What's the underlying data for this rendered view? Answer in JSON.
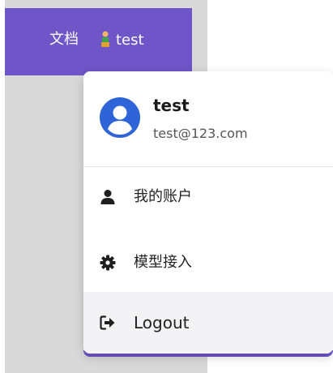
{
  "topbar": {
    "docs_label": "文档",
    "user_name": "test"
  },
  "menu": {
    "user": {
      "name": "test",
      "email": "test@123.com"
    },
    "items": [
      {
        "label": "我的账户",
        "icon": "user-icon"
      },
      {
        "label": "模型接入",
        "icon": "gear-icon"
      },
      {
        "label": "Logout",
        "icon": "logout-icon"
      }
    ]
  },
  "colors": {
    "brand": "#6e56c8",
    "avatar_blue": "#2f64d8",
    "menu_hover": "#f3f3f5"
  }
}
